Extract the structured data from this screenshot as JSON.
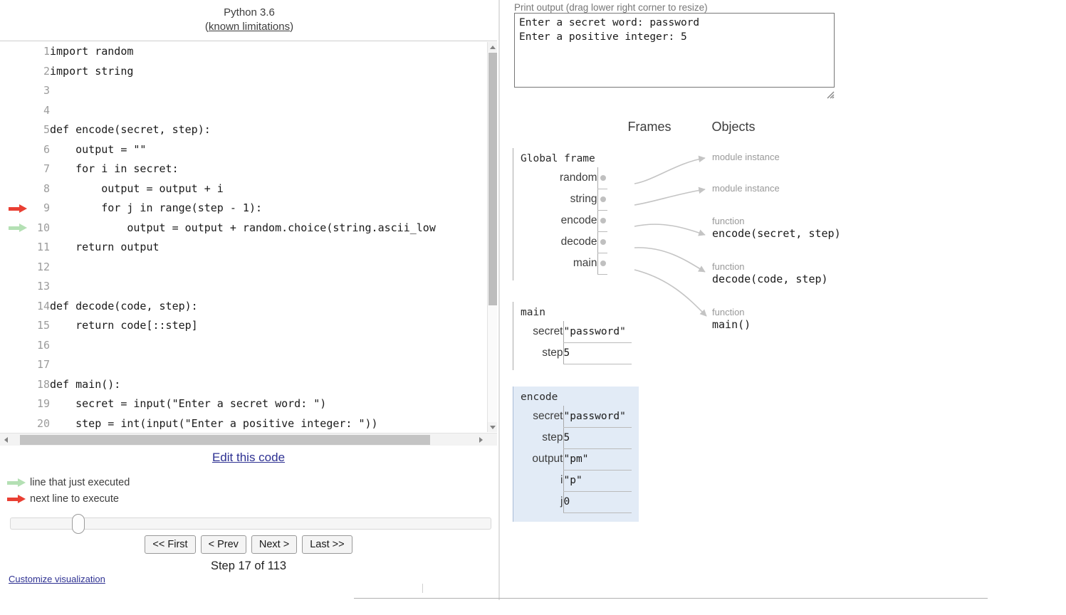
{
  "header": {
    "python_version": "Python 3.6",
    "limitations_open": "(",
    "limitations_link": "known limitations",
    "limitations_close": ")"
  },
  "code": {
    "lines": [
      {
        "num": "1",
        "text": "import random",
        "arrow": ""
      },
      {
        "num": "2",
        "text": "import string",
        "arrow": ""
      },
      {
        "num": "3",
        "text": "",
        "arrow": ""
      },
      {
        "num": "4",
        "text": "",
        "arrow": ""
      },
      {
        "num": "5",
        "text": "def encode(secret, step):",
        "arrow": ""
      },
      {
        "num": "6",
        "text": "    output = \"\"",
        "arrow": ""
      },
      {
        "num": "7",
        "text": "    for i in secret:",
        "arrow": ""
      },
      {
        "num": "8",
        "text": "        output = output + i",
        "arrow": ""
      },
      {
        "num": "9",
        "text": "        for j in range(step - 1):",
        "arrow": "red"
      },
      {
        "num": "10",
        "text": "            output = output + random.choice(string.ascii_low",
        "arrow": "green"
      },
      {
        "num": "11",
        "text": "    return output",
        "arrow": ""
      },
      {
        "num": "12",
        "text": "",
        "arrow": ""
      },
      {
        "num": "13",
        "text": "",
        "arrow": ""
      },
      {
        "num": "14",
        "text": "def decode(code, step):",
        "arrow": ""
      },
      {
        "num": "15",
        "text": "    return code[::step]",
        "arrow": ""
      },
      {
        "num": "16",
        "text": "",
        "arrow": ""
      },
      {
        "num": "17",
        "text": "",
        "arrow": ""
      },
      {
        "num": "18",
        "text": "def main():",
        "arrow": ""
      },
      {
        "num": "19",
        "text": "    secret = input(\"Enter a secret word: \")",
        "arrow": ""
      },
      {
        "num": "20",
        "text": "    step = int(input(\"Enter a positive integer: \"))",
        "arrow": ""
      }
    ]
  },
  "controls": {
    "edit_code_label": "Edit this code",
    "legend_just_executed": "line that just executed",
    "legend_next_line": "next line to execute",
    "first_label": "<< First",
    "prev_label": "< Prev",
    "next_label": "Next >",
    "last_label": "Last >>",
    "step_label": "Step 17 of 113",
    "customize_label": "Customize visualization"
  },
  "output": {
    "label": "Print output (drag lower right corner to resize)",
    "text": "Enter a secret word: password\nEnter a positive integer: 5"
  },
  "viz": {
    "frames_heading": "Frames",
    "objects_heading": "Objects",
    "frames": [
      {
        "title": "Global frame",
        "highlight": false,
        "vars": [
          {
            "name": "random",
            "value": "",
            "pointer": true
          },
          {
            "name": "string",
            "value": "",
            "pointer": true
          },
          {
            "name": "encode",
            "value": "",
            "pointer": true
          },
          {
            "name": "decode",
            "value": "",
            "pointer": true
          },
          {
            "name": "main",
            "value": "",
            "pointer": true
          }
        ]
      },
      {
        "title": "main",
        "highlight": false,
        "vars": [
          {
            "name": "secret",
            "value": "\"password\"",
            "pointer": false
          },
          {
            "name": "step",
            "value": "5",
            "pointer": false
          }
        ]
      },
      {
        "title": "encode",
        "highlight": true,
        "vars": [
          {
            "name": "secret",
            "value": "\"password\"",
            "pointer": false
          },
          {
            "name": "step",
            "value": "5",
            "pointer": false
          },
          {
            "name": "output",
            "value": "\"pm\"",
            "pointer": false
          },
          {
            "name": "i",
            "value": "\"p\"",
            "pointer": false
          },
          {
            "name": "j",
            "value": "0",
            "pointer": false
          }
        ]
      }
    ],
    "objects": [
      {
        "type": "module instance",
        "body": ""
      },
      {
        "type": "module instance",
        "body": ""
      },
      {
        "type": "function",
        "body": "encode(secret, step)"
      },
      {
        "type": "function",
        "body": "decode(code, step)"
      },
      {
        "type": "function",
        "body": "main()"
      }
    ]
  },
  "colors": {
    "red_arrow": "#e93f33",
    "green_arrow": "#b4e0b4",
    "link": "#2e3192",
    "frame_highlight": "#e2ebf6",
    "connector": "#c4c4c4"
  }
}
